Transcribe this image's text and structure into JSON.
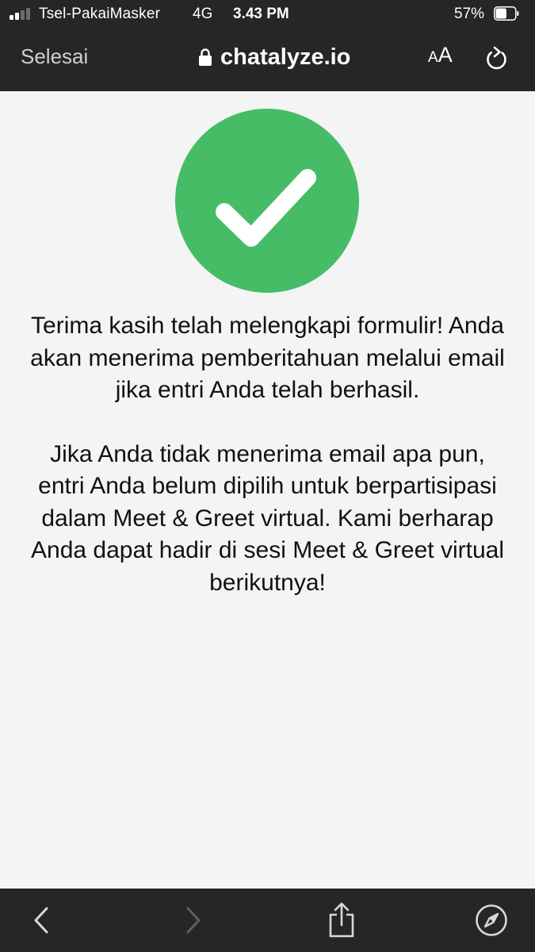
{
  "status_bar": {
    "carrier": "Tsel-PakaiMasker",
    "network": "4G",
    "time": "3.43 PM",
    "battery_percent": "57%",
    "battery_level": 0.57,
    "signal_bars_active": 2,
    "signal_bars_total": 4
  },
  "nav": {
    "done_label": "Selesai",
    "url": "chatalyze.io",
    "text_size_small": "A",
    "text_size_large": "A",
    "lock_icon": "lock-icon",
    "reload_icon": "reload-icon"
  },
  "content": {
    "status_icon": "checkmark-circle-icon",
    "status_color": "#46bc66",
    "paragraph_1": "Terima kasih telah melengkapi formulir! Anda akan menerima pemberitahuan melalui email jika entri Anda telah berhasil.",
    "paragraph_2": "Jika Anda tidak menerima email apa pun, entri Anda belum dipilih untuk berpartisipasi dalam Meet & Greet virtual. Kami berharap Anda dapat hadir di sesi Meet & Greet virtual berikutnya!"
  },
  "toolbar": {
    "back_icon": "chevron-left-icon",
    "forward_icon": "chevron-right-icon",
    "share_icon": "share-icon",
    "safari_icon": "compass-icon"
  },
  "colors": {
    "chrome_background": "#262626",
    "page_background": "#f4f4f4",
    "success_green": "#46bc66"
  }
}
